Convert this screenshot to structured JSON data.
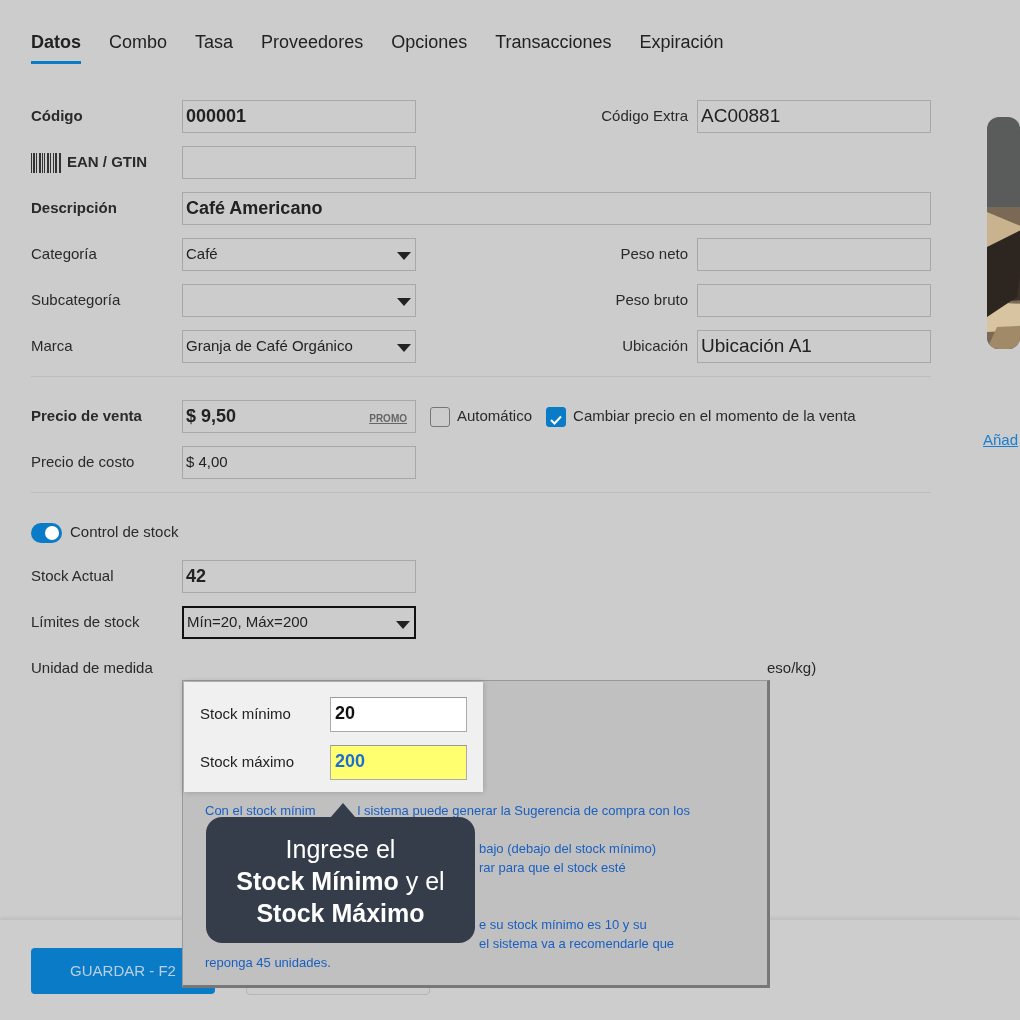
{
  "tabs": [
    {
      "label": "Datos",
      "selected": true
    },
    {
      "label": "Combo",
      "selected": false
    },
    {
      "label": "Tasa",
      "selected": false
    },
    {
      "label": "Proveedores",
      "selected": false
    },
    {
      "label": "Opciones",
      "selected": false
    },
    {
      "label": "Transacciones",
      "selected": false
    },
    {
      "label": "Expiración",
      "selected": false
    }
  ],
  "product_rows": [
    {
      "label": "Código",
      "required": true,
      "field": {
        "kind": "input",
        "value": "000001"
      },
      "right": {
        "label": "Código Extra",
        "field": {
          "kind": "input",
          "value": "AC00881"
        }
      }
    },
    {
      "label": "EAN / GTIN",
      "required": true,
      "field": {
        "kind": "input"
      }
    },
    {
      "label": "Descripción",
      "required": true,
      "field": {
        "kind": "input",
        "value": "Café Americano",
        "wide": true
      }
    },
    {
      "label": "Categoría",
      "required": false,
      "field": {
        "kind": "select",
        "value": "Café"
      },
      "right": {
        "label": "Peso neto",
        "field": {
          "kind": "input"
        }
      }
    },
    {
      "label": "Subcategoría",
      "required": false,
      "field": {
        "kind": "select"
      },
      "right": {
        "label": "Peso bruto",
        "field": {
          "kind": "input"
        }
      }
    },
    {
      "label": "Marca",
      "required": false,
      "field": {
        "kind": "select",
        "value": "Granja de Café Orgánico"
      },
      "right": {
        "label": "Ubicación",
        "field": {
          "kind": "input",
          "value": "Ubicación A1"
        }
      }
    }
  ],
  "price_rows": [
    {
      "label": "Precio de venta",
      "required": true,
      "field": {
        "kind": "input",
        "value": "$ 9,50",
        "link": "PROMO"
      }
    },
    {
      "label": "Precio de costo",
      "required": false,
      "field": {
        "kind": "input",
        "value": "$ 4,00"
      }
    }
  ],
  "price_options": [
    {
      "label": "Automático",
      "checked": false
    },
    {
      "label": "Cambiar precio en el momento de la venta",
      "checked": true
    }
  ],
  "stock_control": {
    "label": "Control de stock",
    "on": true
  },
  "stock_rows": [
    {
      "label": "Stock Actual",
      "required": false,
      "field": {
        "kind": "input",
        "value": "42"
      }
    },
    {
      "label": "Límites de stock",
      "required": false,
      "field": {
        "kind": "select",
        "value": "Mín=20, Máx=200",
        "focused": true
      }
    },
    {
      "label": "Unidad de medida",
      "required": false,
      "trailing": "eso/kg)"
    }
  ],
  "image_panel": {
    "kind": "picture",
    "link": "Añad"
  },
  "stock_popup": {
    "fields": [
      {
        "label": "Stock mínimo",
        "value": "20",
        "highlighted": false
      },
      {
        "label": "Stock máximo",
        "value": "200",
        "highlighted": true
      }
    ],
    "help_lines": [
      {
        "before": "Con el stock mínim",
        "after": "l sistema puede generar la Sugerencia de compra con los"
      },
      {
        "after": "bajo (debajo del stock mínimo)"
      },
      {
        "after": "rar para que el stock esté"
      },
      {
        "after": "e su stock mínimo es 10 y su"
      },
      {
        "after": "el sistema va a recomendarle que"
      },
      {
        "before": "reponga 45 unidades."
      }
    ]
  },
  "tooltip_lines": [
    "Ingrese el",
    "**Stock Mínimo** y el",
    "**Stock Máximo**"
  ],
  "footer": {
    "buttons": [
      {
        "label": "GUARDAR - F2",
        "kind": "primary"
      },
      {
        "kind": "outline"
      }
    ]
  }
}
